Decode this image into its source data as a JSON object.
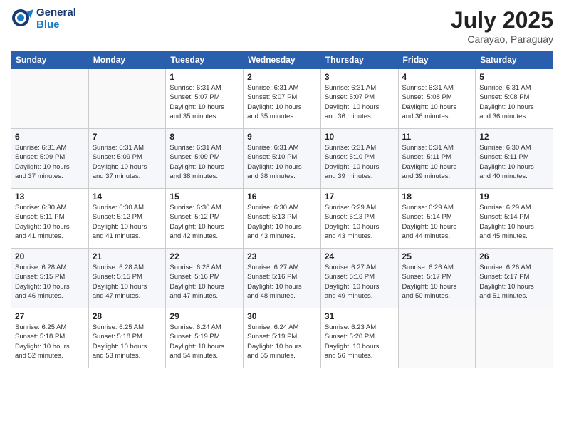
{
  "header": {
    "logo_line1": "General",
    "logo_line2": "Blue",
    "month": "July 2025",
    "location": "Carayao, Paraguay"
  },
  "days_of_week": [
    "Sunday",
    "Monday",
    "Tuesday",
    "Wednesday",
    "Thursday",
    "Friday",
    "Saturday"
  ],
  "weeks": [
    [
      {
        "day": "",
        "info": ""
      },
      {
        "day": "",
        "info": ""
      },
      {
        "day": "1",
        "info": "Sunrise: 6:31 AM\nSunset: 5:07 PM\nDaylight: 10 hours\nand 35 minutes."
      },
      {
        "day": "2",
        "info": "Sunrise: 6:31 AM\nSunset: 5:07 PM\nDaylight: 10 hours\nand 35 minutes."
      },
      {
        "day": "3",
        "info": "Sunrise: 6:31 AM\nSunset: 5:07 PM\nDaylight: 10 hours\nand 36 minutes."
      },
      {
        "day": "4",
        "info": "Sunrise: 6:31 AM\nSunset: 5:08 PM\nDaylight: 10 hours\nand 36 minutes."
      },
      {
        "day": "5",
        "info": "Sunrise: 6:31 AM\nSunset: 5:08 PM\nDaylight: 10 hours\nand 36 minutes."
      }
    ],
    [
      {
        "day": "6",
        "info": "Sunrise: 6:31 AM\nSunset: 5:09 PM\nDaylight: 10 hours\nand 37 minutes."
      },
      {
        "day": "7",
        "info": "Sunrise: 6:31 AM\nSunset: 5:09 PM\nDaylight: 10 hours\nand 37 minutes."
      },
      {
        "day": "8",
        "info": "Sunrise: 6:31 AM\nSunset: 5:09 PM\nDaylight: 10 hours\nand 38 minutes."
      },
      {
        "day": "9",
        "info": "Sunrise: 6:31 AM\nSunset: 5:10 PM\nDaylight: 10 hours\nand 38 minutes."
      },
      {
        "day": "10",
        "info": "Sunrise: 6:31 AM\nSunset: 5:10 PM\nDaylight: 10 hours\nand 39 minutes."
      },
      {
        "day": "11",
        "info": "Sunrise: 6:31 AM\nSunset: 5:11 PM\nDaylight: 10 hours\nand 39 minutes."
      },
      {
        "day": "12",
        "info": "Sunrise: 6:30 AM\nSunset: 5:11 PM\nDaylight: 10 hours\nand 40 minutes."
      }
    ],
    [
      {
        "day": "13",
        "info": "Sunrise: 6:30 AM\nSunset: 5:11 PM\nDaylight: 10 hours\nand 41 minutes."
      },
      {
        "day": "14",
        "info": "Sunrise: 6:30 AM\nSunset: 5:12 PM\nDaylight: 10 hours\nand 41 minutes."
      },
      {
        "day": "15",
        "info": "Sunrise: 6:30 AM\nSunset: 5:12 PM\nDaylight: 10 hours\nand 42 minutes."
      },
      {
        "day": "16",
        "info": "Sunrise: 6:30 AM\nSunset: 5:13 PM\nDaylight: 10 hours\nand 43 minutes."
      },
      {
        "day": "17",
        "info": "Sunrise: 6:29 AM\nSunset: 5:13 PM\nDaylight: 10 hours\nand 43 minutes."
      },
      {
        "day": "18",
        "info": "Sunrise: 6:29 AM\nSunset: 5:14 PM\nDaylight: 10 hours\nand 44 minutes."
      },
      {
        "day": "19",
        "info": "Sunrise: 6:29 AM\nSunset: 5:14 PM\nDaylight: 10 hours\nand 45 minutes."
      }
    ],
    [
      {
        "day": "20",
        "info": "Sunrise: 6:28 AM\nSunset: 5:15 PM\nDaylight: 10 hours\nand 46 minutes."
      },
      {
        "day": "21",
        "info": "Sunrise: 6:28 AM\nSunset: 5:15 PM\nDaylight: 10 hours\nand 47 minutes."
      },
      {
        "day": "22",
        "info": "Sunrise: 6:28 AM\nSunset: 5:16 PM\nDaylight: 10 hours\nand 47 minutes."
      },
      {
        "day": "23",
        "info": "Sunrise: 6:27 AM\nSunset: 5:16 PM\nDaylight: 10 hours\nand 48 minutes."
      },
      {
        "day": "24",
        "info": "Sunrise: 6:27 AM\nSunset: 5:16 PM\nDaylight: 10 hours\nand 49 minutes."
      },
      {
        "day": "25",
        "info": "Sunrise: 6:26 AM\nSunset: 5:17 PM\nDaylight: 10 hours\nand 50 minutes."
      },
      {
        "day": "26",
        "info": "Sunrise: 6:26 AM\nSunset: 5:17 PM\nDaylight: 10 hours\nand 51 minutes."
      }
    ],
    [
      {
        "day": "27",
        "info": "Sunrise: 6:25 AM\nSunset: 5:18 PM\nDaylight: 10 hours\nand 52 minutes."
      },
      {
        "day": "28",
        "info": "Sunrise: 6:25 AM\nSunset: 5:18 PM\nDaylight: 10 hours\nand 53 minutes."
      },
      {
        "day": "29",
        "info": "Sunrise: 6:24 AM\nSunset: 5:19 PM\nDaylight: 10 hours\nand 54 minutes."
      },
      {
        "day": "30",
        "info": "Sunrise: 6:24 AM\nSunset: 5:19 PM\nDaylight: 10 hours\nand 55 minutes."
      },
      {
        "day": "31",
        "info": "Sunrise: 6:23 AM\nSunset: 5:20 PM\nDaylight: 10 hours\nand 56 minutes."
      },
      {
        "day": "",
        "info": ""
      },
      {
        "day": "",
        "info": ""
      }
    ]
  ]
}
